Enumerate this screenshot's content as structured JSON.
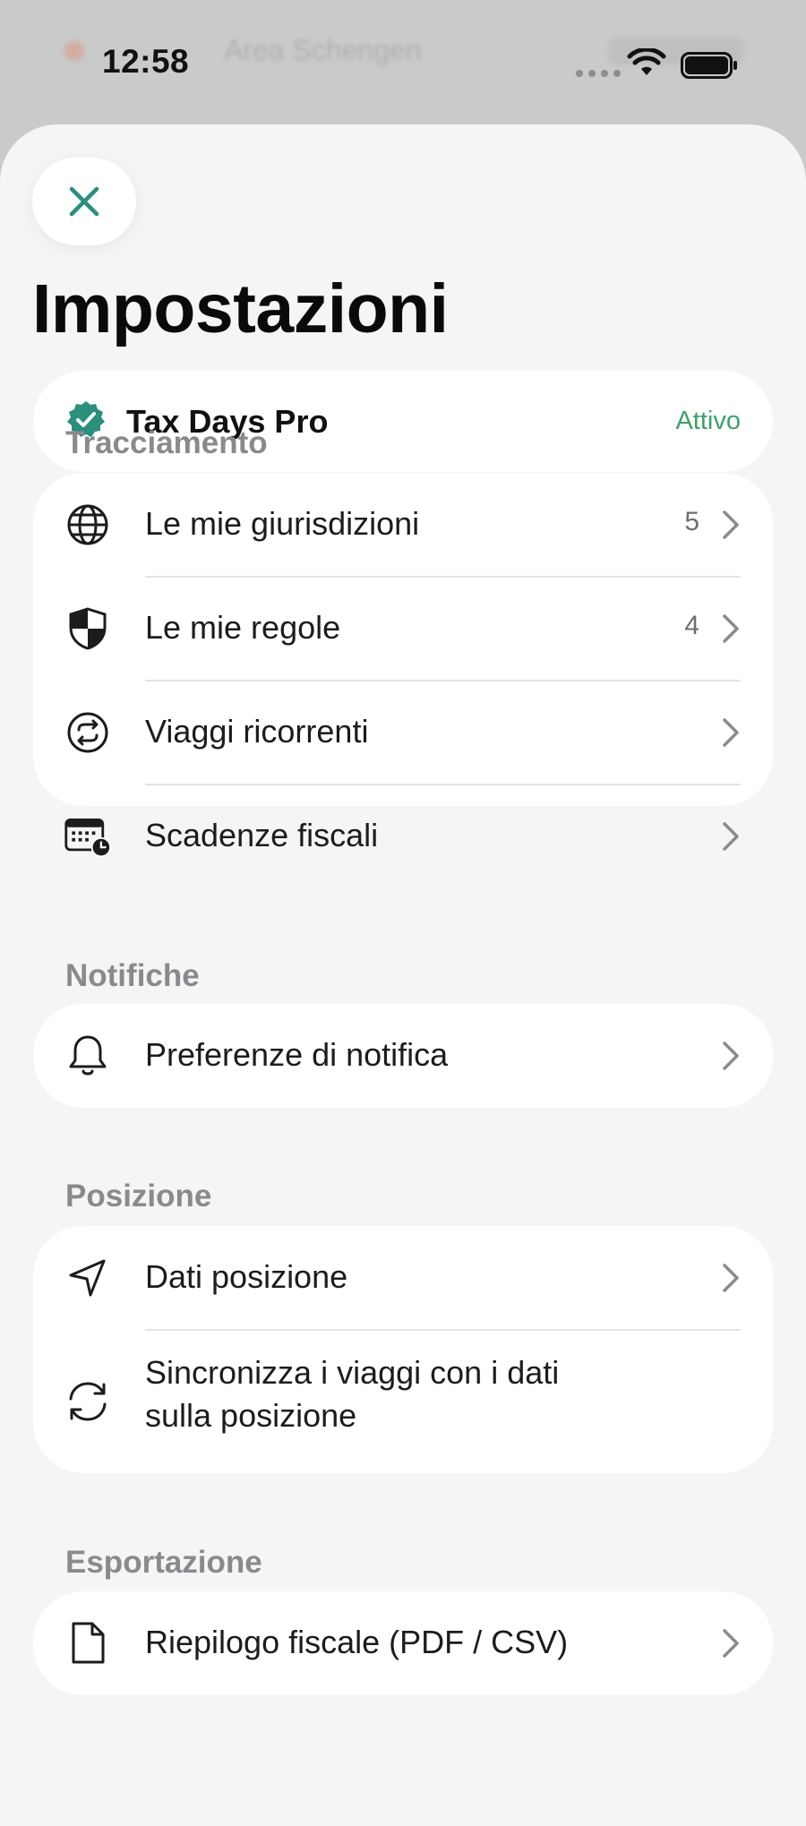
{
  "status_bar": {
    "time": "12:58",
    "background_text": "Area Schengen"
  },
  "header": {
    "title": "Impostazioni",
    "close_icon": "close-icon"
  },
  "pro": {
    "label": "Tax Days Pro",
    "status": "Attivo",
    "icon": "verified-badge-icon"
  },
  "sections": {
    "tracking": {
      "title": "Tracciamento",
      "items": [
        {
          "label": "Le mie giurisdizioni",
          "count": "5",
          "icon": "globe-icon"
        },
        {
          "label": "Le mie regole",
          "count": "4",
          "icon": "shield-icon"
        },
        {
          "label": "Viaggi ricorrenti",
          "count": "",
          "icon": "repeat-icon"
        },
        {
          "label": "Scadenze fiscali",
          "count": "",
          "icon": "calendar-clock-icon"
        }
      ]
    },
    "notifications": {
      "title": "Notifiche",
      "items": [
        {
          "label": "Preferenze di notifica",
          "icon": "bell-icon"
        }
      ]
    },
    "location": {
      "title": "Posizione",
      "items": [
        {
          "label": "Dati posizione",
          "icon": "location-arrow-icon"
        },
        {
          "label_line1": "Sincronizza i viaggi con i dati",
          "label_line2": "sulla posizione",
          "icon": "sync-icon"
        }
      ]
    },
    "export": {
      "title": "Esportazione",
      "items": [
        {
          "label": "Riepilogo fiscale (PDF / CSV)",
          "icon": "document-icon"
        }
      ]
    }
  },
  "colors": {
    "accent": "#2a8f7d",
    "status_green": "#3fa06a",
    "sheet_bg": "#f4f5f5",
    "card_bg": "#ffffff",
    "section_text": "#8a8a8e"
  }
}
